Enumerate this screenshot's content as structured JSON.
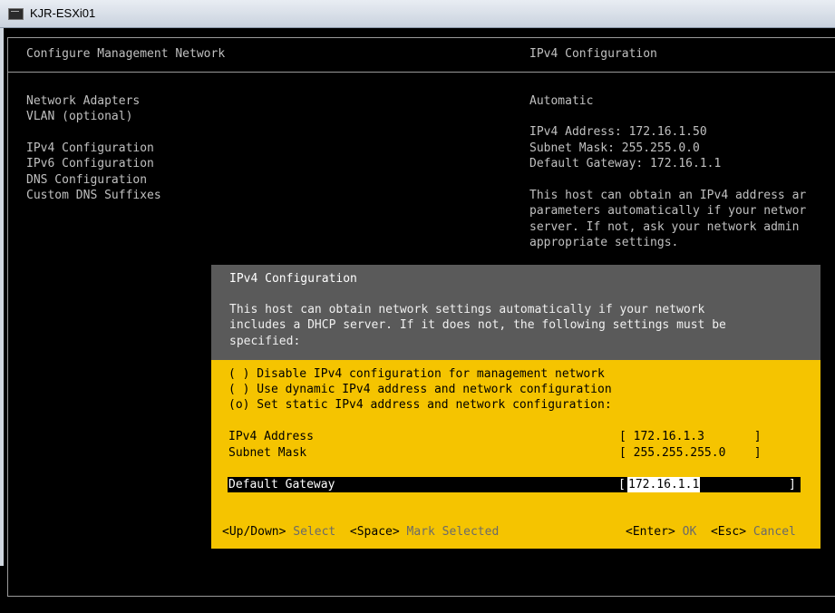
{
  "window": {
    "title": "KJR-ESXi01"
  },
  "console": {
    "header_left": "Configure Management Network",
    "header_right": "IPv4 Configuration",
    "menu": [
      "Network Adapters",
      "VLAN (optional)",
      "IPv4 Configuration",
      "IPv6 Configuration",
      "DNS Configuration",
      "Custom DNS Suffixes"
    ],
    "right_mode": "Automatic",
    "right_ip": "IPv4 Address: 172.16.1.50",
    "right_mask": "Subnet Mask: 255.255.0.0",
    "right_gw": "Default Gateway: 172.16.1.1",
    "right_desc": "This host can obtain an IPv4 address ar\nparameters automatically if your networ\nserver. If not, ask your network admin\nappropriate settings."
  },
  "dialog": {
    "title": "IPv4 Configuration",
    "description": "This host can obtain network settings automatically if your network\nincludes a DHCP server. If it does not, the following settings must be\nspecified:",
    "options": [
      "( ) Disable IPv4 configuration for management network",
      "( ) Use dynamic IPv4 address and network configuration",
      "(o) Set static IPv4 address and network configuration:"
    ],
    "fields": {
      "ipv4_label": "IPv4 Address",
      "ipv4_value": "[ 172.16.1.3       ]",
      "mask_label": "Subnet Mask",
      "mask_value": "[ 255.255.255.0    ]",
      "gateway_label": "Default Gateway",
      "gateway_bracket_open": "[",
      "gateway_value": "172.16.1.1",
      "gateway_bracket_close": "]"
    },
    "footer": {
      "updown_key": "<Up/Down>",
      "updown_action": " Select  ",
      "space_key": "<Space>",
      "space_action": " Mark Selected",
      "enter_key": "<Enter>",
      "enter_action": " OK  ",
      "esc_key": "<Esc>",
      "esc_action": " Cancel"
    }
  }
}
